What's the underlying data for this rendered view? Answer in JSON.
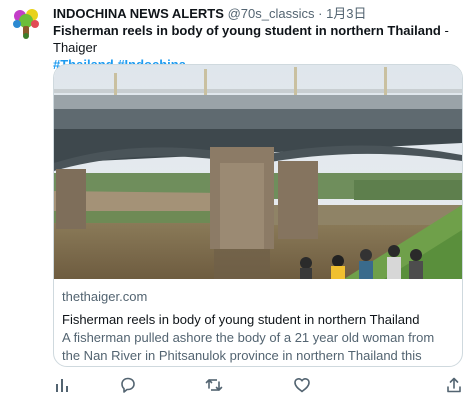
{
  "author": {
    "name": "INDOCHINA NEWS ALERTS",
    "handle": "@70s_classics",
    "separator": "·",
    "time": "1月3日"
  },
  "tweet": {
    "headline": "Fisherman reels in body of young student in northern Thailand",
    "separator": " - ",
    "source": "Thaiger",
    "hashtags": [
      "#Thailand",
      "#Indochina"
    ]
  },
  "card": {
    "domain": "thethaiger.com",
    "title": "Fisherman reels in body of young student in northern Thailand",
    "description": "A fisherman pulled ashore the body of a 21 year old woman from the Nan River in Phitsanulok province in northern Thailand this morning."
  },
  "actions": [
    {
      "name": "analytics-icon"
    },
    {
      "name": "reply-icon"
    },
    {
      "name": "retweet-icon"
    },
    {
      "name": "like-icon"
    },
    {
      "name": "share-icon"
    }
  ],
  "colors": {
    "hashtag": "#1d9bf0",
    "secondary_text": "#536471",
    "border": "#cfd9de"
  }
}
